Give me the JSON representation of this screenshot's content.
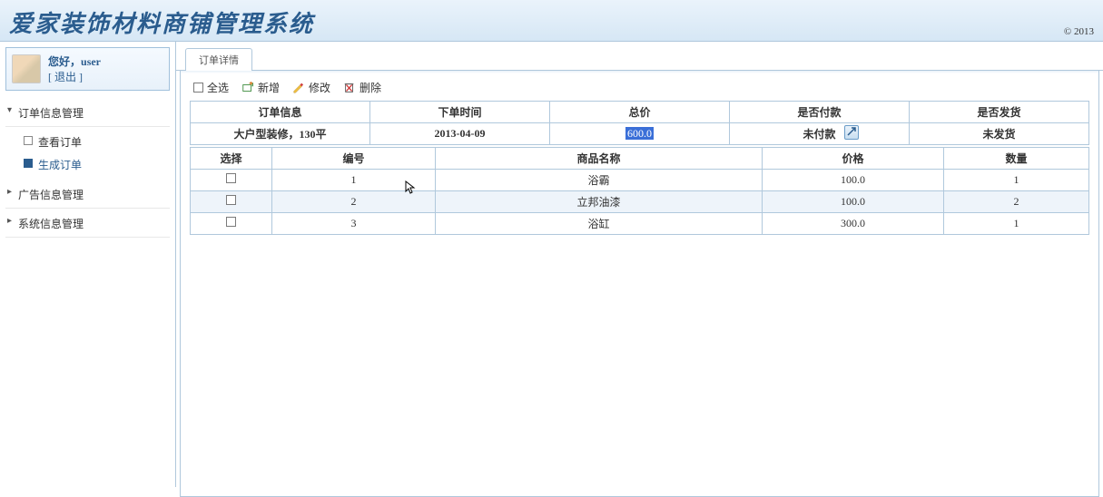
{
  "header": {
    "title": "爱家装饰材料商铺管理系统",
    "copyright": "© 2013"
  },
  "user": {
    "greeting_prefix": "您好，",
    "username": "user",
    "logout": "[ 退出 ]"
  },
  "sidebar": {
    "sections": [
      {
        "label": "订单信息管理",
        "expanded": true,
        "items": [
          {
            "label": "查看订单",
            "active": false
          },
          {
            "label": "生成订单",
            "active": true
          }
        ]
      },
      {
        "label": "广告信息管理",
        "expanded": false
      },
      {
        "label": "系统信息管理",
        "expanded": false
      }
    ]
  },
  "tab": {
    "label": "订单详情"
  },
  "toolbar": {
    "selectAll": "全选",
    "add": "新增",
    "edit": "修改",
    "del": "删除"
  },
  "orderTable": {
    "headers": {
      "info": "订单信息",
      "time": "下单时间",
      "total": "总价",
      "paid": "是否付款",
      "shipped": "是否发货"
    },
    "row": {
      "info": "大户型装修，130平",
      "time": "2013-04-09",
      "total": "600.0",
      "paid": "未付款",
      "shipped": "未发货"
    }
  },
  "itemsTable": {
    "headers": {
      "select": "选择",
      "id": "编号",
      "name": "商品名称",
      "price": "价格",
      "qty": "数量"
    },
    "rows": [
      {
        "id": "1",
        "name": "浴霸",
        "price": "100.0",
        "qty": "1"
      },
      {
        "id": "2",
        "name": "立邦油漆",
        "price": "100.0",
        "qty": "2"
      },
      {
        "id": "3",
        "name": "浴缸",
        "price": "300.0",
        "qty": "1"
      }
    ]
  }
}
